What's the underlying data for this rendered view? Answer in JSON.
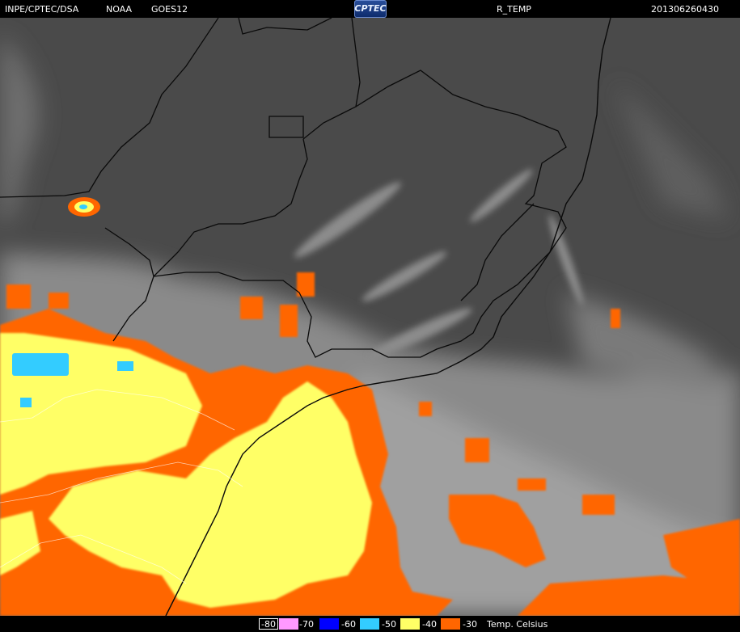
{
  "header": {
    "agency": "INPE/CPTEC/DSA",
    "source": "NOAA",
    "satellite": "GOES12",
    "logo_text": "CPTEC",
    "product": "R_TEMP",
    "timestamp": "201306260430"
  },
  "legend": {
    "unit_label": "Temp. Celsius",
    "items": [
      {
        "label": "-80",
        "color": "#ff99ff"
      },
      {
        "label": "-70",
        "color": "#0000ff"
      },
      {
        "label": "-60",
        "color": "#33ccff"
      },
      {
        "label": "-50",
        "color": "#ffff66"
      },
      {
        "label": "-40",
        "color": "#ff6600"
      },
      {
        "label": "-30",
        "color": "#000000"
      }
    ]
  },
  "map": {
    "background_color": "#4a4a4a",
    "cloud_colors": {
      "gray_cloud": "#9a9a9a",
      "cold_orange": "#ff6600",
      "very_cold_yellow": "#ffff66",
      "cyan": "#33ccff"
    }
  }
}
